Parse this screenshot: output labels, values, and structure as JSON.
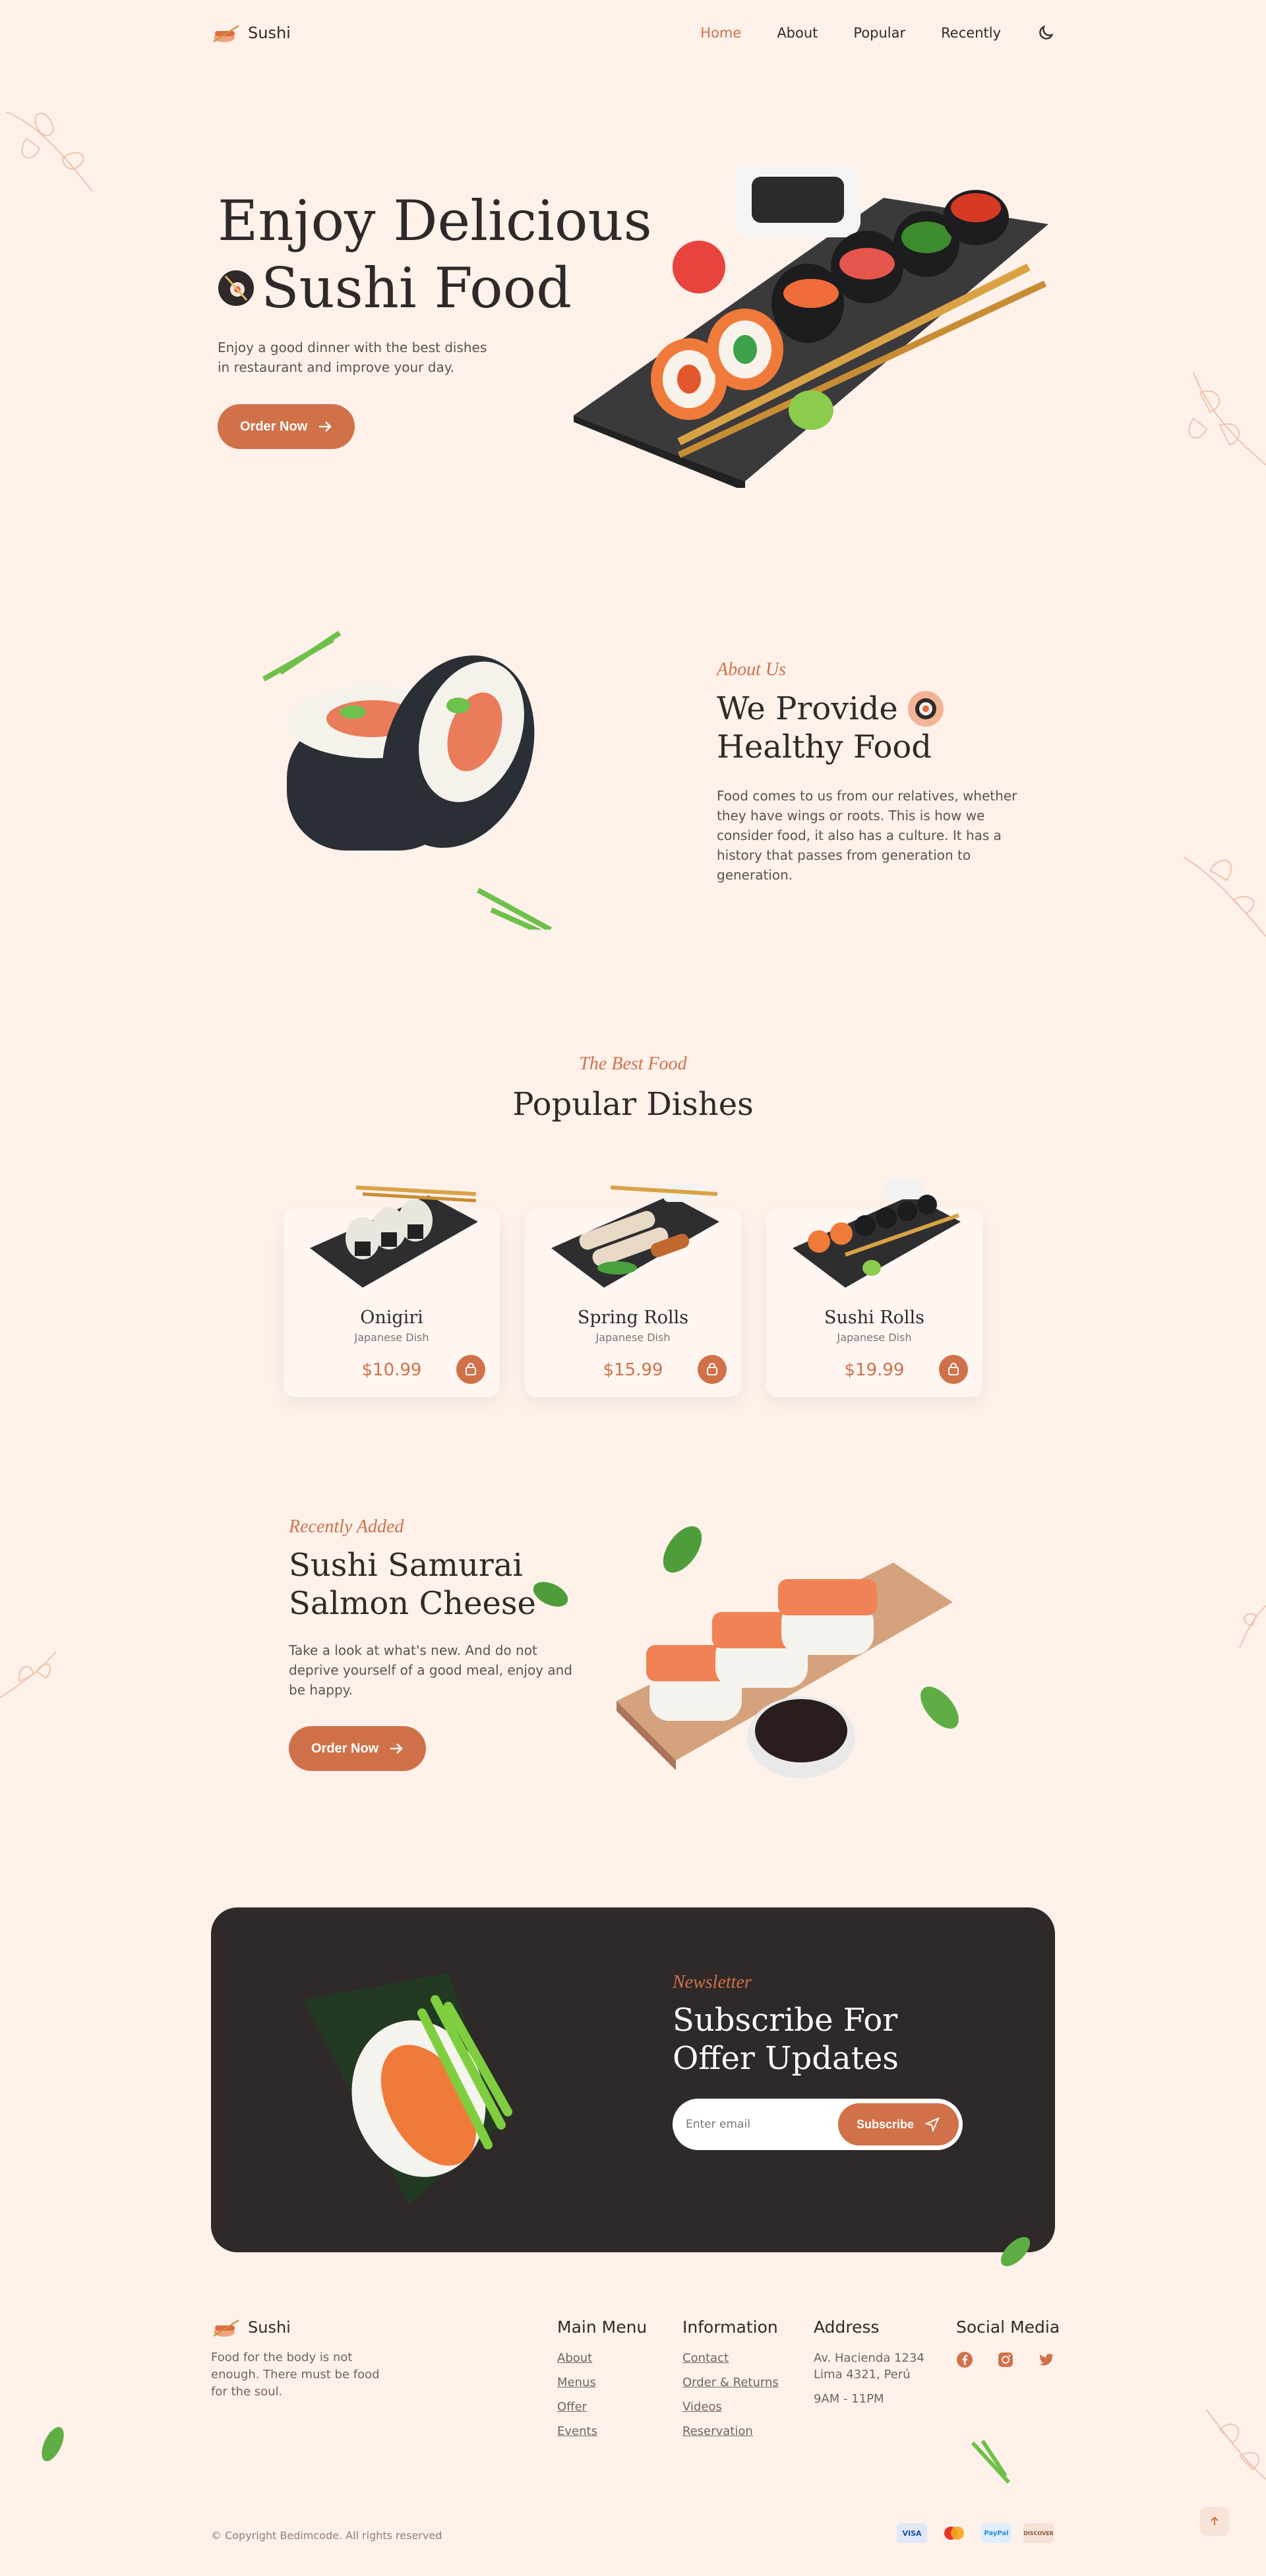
{
  "brand": {
    "name": "Sushi"
  },
  "nav": {
    "items": [
      "Home",
      "About",
      "Popular",
      "Recently"
    ],
    "active": "Home"
  },
  "hero": {
    "title_line1": "Enjoy Delicious",
    "title_line2": "Sushi Food",
    "description": "Enjoy a good dinner with the best dishes in restaurant and improve your day.",
    "button": "Order Now"
  },
  "about": {
    "kicker": "About Us",
    "title_line1": "We Provide",
    "title_line2": "Healthy Food",
    "description": "Food comes to us from our relatives, whether they have wings or roots. This is how we consider food, it also has a culture. It has a history that passes from generation to generation."
  },
  "popular": {
    "kicker": "The Best Food",
    "title": "Popular Dishes",
    "dishes": [
      {
        "name": "Onigiri",
        "type": "Japanese Dish",
        "price": "$10.99"
      },
      {
        "name": "Spring Rolls",
        "type": "Japanese Dish",
        "price": "$15.99"
      },
      {
        "name": "Sushi Rolls",
        "type": "Japanese Dish",
        "price": "$19.99"
      }
    ]
  },
  "recently": {
    "kicker": "Recently Added",
    "title_line1": "Sushi Samurai",
    "title_line2": "Salmon Cheese",
    "description": "Take a look at what's new. And do not deprive yourself of a good meal, enjoy and be happy.",
    "button": "Order Now"
  },
  "newsletter": {
    "kicker": "Newsletter",
    "title_line1": "Subscribe For",
    "title_line2": "Offer Updates",
    "placeholder": "Enter email",
    "button": "Subscribe"
  },
  "footer": {
    "tagline": "Food for the body is not enough. There must be food for the soul.",
    "main_menu": {
      "title": "Main Menu",
      "links": [
        "About",
        "Menus",
        "Offer",
        "Events"
      ]
    },
    "information": {
      "title": "Information",
      "links": [
        "Contact",
        "Order & Returns",
        "Videos",
        "Reservation"
      ]
    },
    "address": {
      "title": "Address",
      "line1": "Av. Hacienda 1234",
      "line2": "Lima 4321, Perú",
      "hours": "9AM - 11PM"
    },
    "social": {
      "title": "Social Media",
      "icons": [
        "facebook-icon",
        "instagram-icon",
        "twitter-icon"
      ]
    },
    "copyright": "© Copyright Bedimcode. All rights reserved",
    "payments": [
      "VISA",
      "mastercard",
      "PayPal",
      "DISCOVER"
    ]
  },
  "colors": {
    "accent": "#d0714a",
    "background": "#fdf1ea",
    "dark": "#2f2a29"
  }
}
